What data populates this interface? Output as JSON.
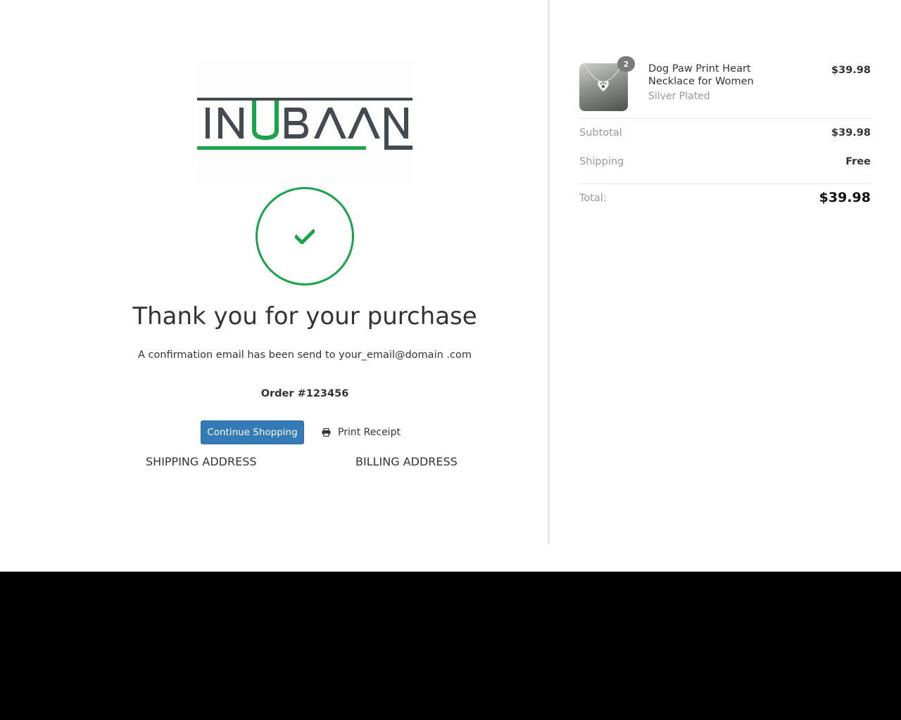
{
  "brand": {
    "logo_text": "INUBAAN",
    "logo_green": "#1aa34a",
    "logo_gray": "#444a50"
  },
  "confirmation": {
    "title": "Thank you for your purchase",
    "message": "A confirmation email has been send to your_email@domain .com",
    "order_number": "Order #123456",
    "success_color": "#1aa34a"
  },
  "actions": {
    "continue_label": "Continue Shopping",
    "print_label": "Print Receipt",
    "primary_color": "#337ab7"
  },
  "addresses": {
    "shipping_heading": "SHIPPING ADDRESS",
    "billing_heading": "BILLING ADDRESS"
  },
  "summary": {
    "item": {
      "name": "Dog Paw Print Heart Necklace for Women",
      "variant": "Silver Plated",
      "quantity": "2",
      "price": "$39.98"
    },
    "subtotal_label": "Subtotal",
    "subtotal_value": "$39.98",
    "shipping_label": "Shipping",
    "shipping_value": "Free",
    "total_label": "Total:",
    "total_value": "$39.98"
  }
}
